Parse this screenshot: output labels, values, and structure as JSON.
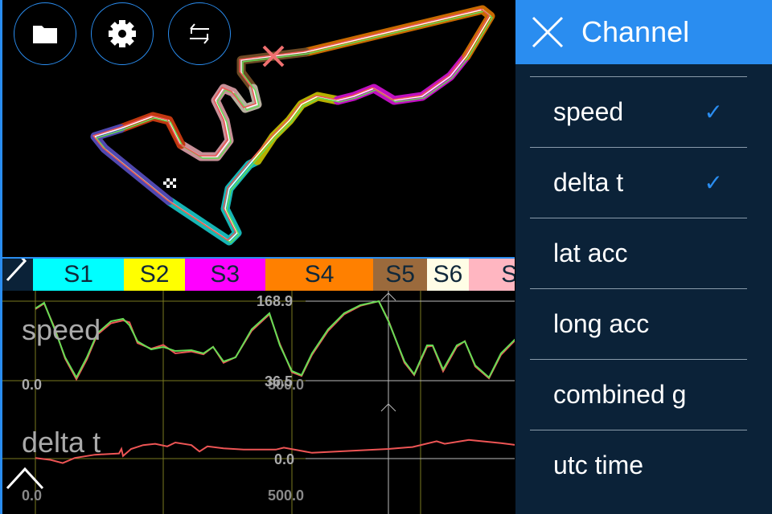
{
  "toolbar": {
    "buttons": [
      {
        "icon": "folder-icon"
      },
      {
        "icon": "gear-icon"
      },
      {
        "icon": "swap-icon"
      }
    ]
  },
  "sections": [
    {
      "label": "S1",
      "color": "#00ffff"
    },
    {
      "label": "S2",
      "color": "#ffff00"
    },
    {
      "label": "S3",
      "color": "#ff00ff"
    },
    {
      "label": "S4",
      "color": "#ff8000"
    },
    {
      "label": "S5",
      "color": "#9b6a3c"
    },
    {
      "label": "S6",
      "color": "#fffde6"
    },
    {
      "label": "S",
      "color": "#ffb6c1"
    }
  ],
  "graph": {
    "speed_label": "speed",
    "speed_max": "168.9",
    "speed_min_label": "0.0",
    "speed_cursor_value": "36.5",
    "delta_label": "delta t",
    "delta_zero": "0.0",
    "x_tick_0": "0.0",
    "x_tick_500": "500.0",
    "x_overlap_tick": "500.0"
  },
  "chart_data": {
    "type": "line",
    "x": [
      0,
      17,
      37.5,
      57.8,
      79.7,
      100,
      120.3,
      146.9,
      170.3,
      182.8,
      198.4,
      225,
      248.4,
      271.9,
      303.1,
      326.6,
      345.3,
      365.6,
      389,
      420.3,
      454.7,
      475,
      498.4,
      517.2,
      537.5,
      568.8,
      600,
      631.3,
      667.2,
      686,
      717.2,
      736,
      760.9,
      771.9,
      792.2,
      818.8,
      834.4,
      854.7,
      881.3,
      904.7,
      935.9
    ],
    "ylim": [
      0,
      168.9
    ],
    "series": [
      {
        "color": "#66dd55",
        "values": [
          153.5,
          165.5,
          109.2,
          49.5,
          6.8,
          49.5,
          100.7,
          126.2,
          131.4,
          117.7,
          83.6,
          66.5,
          71.7,
          63.1,
          64.8,
          58,
          71.7,
          40.9,
          49.5,
          109.2,
          143.3,
          75.1,
          20.5,
          11.9,
          58,
          109.2,
          143.3,
          160.4,
          168.9,
          126.2,
          40.9,
          13.6,
          75.1,
          75.1,
          23.9,
          75.1,
          83.6,
          32.4,
          6.8,
          58,
          92.1
        ]
      },
      {
        "color": "#ee5555",
        "values": [
          152,
          164,
          112,
          47,
          3,
          45,
          98,
          122,
          128,
          124,
          80,
          68,
          76,
          58,
          62,
          56,
          72,
          38,
          50,
          106,
          141,
          78,
          18,
          10,
          55,
          106,
          141,
          159,
          168.9,
          128,
          38,
          12,
          72,
          74,
          20,
          72,
          84,
          30,
          5,
          55,
          90
        ]
      }
    ],
    "delta": {
      "color": "#ee5555",
      "x": [
        0,
        29.7,
        53.1,
        76.6,
        115.6,
        162.5,
        167.2,
        170.3,
        186,
        209.4,
        232.8,
        256.3,
        271.9,
        303.1,
        318.8,
        334.4,
        365.6,
        404.7,
        467.2,
        482.8,
        537.5,
        685.9,
        732.8,
        779.7,
        795.3,
        842.2,
        904.7,
        935.9
      ],
      "values": [
        0.02,
        -0.04,
        -0.14,
        0.02,
        0.12,
        0.16,
        0.3,
        0.08,
        0.3,
        0.42,
        0.46,
        0.38,
        0.5,
        0.42,
        0.22,
        0.38,
        0.32,
        0.28,
        0.28,
        0.34,
        0.18,
        0.3,
        0.36,
        0.54,
        0.46,
        0.58,
        0.48,
        0.42
      ]
    }
  },
  "panel": {
    "title": "Channel",
    "items": [
      {
        "label": "speed",
        "checked": "✓"
      },
      {
        "label": "delta t",
        "checked": "✓"
      },
      {
        "label": "lat acc"
      },
      {
        "label": "long acc"
      },
      {
        "label": "combined g"
      },
      {
        "label": "utc time"
      }
    ]
  }
}
